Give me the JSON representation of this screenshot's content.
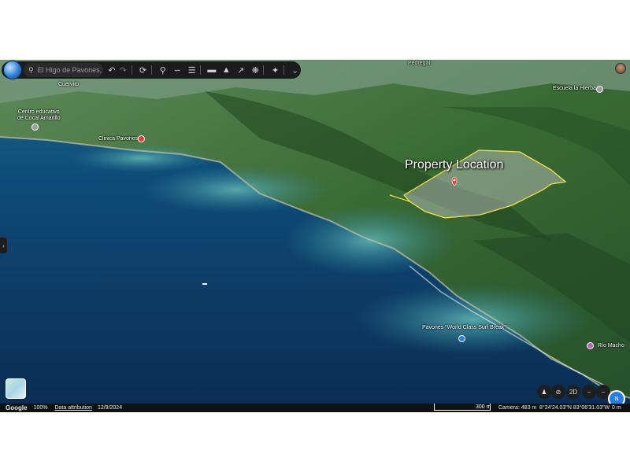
{
  "toolbar": {
    "search_value": "El Higo de Pavones, adjac"
  },
  "places": {
    "cuervito": "Cuervito",
    "pedregal": "Pedregal",
    "centro_line1": "Centro educativo",
    "centro_line2": "de Cocal Amarillo",
    "clinica": "Clinica Pavones",
    "escuela": "Escuela la Hierba",
    "surf_break": "Pavones \"World Class Surf Break\"",
    "rio_macho": "Río Macho"
  },
  "overlay": {
    "property_label": "Property Location",
    "polygon_color": "#f2e24a",
    "marker_color": "#e53935"
  },
  "controls": {
    "view_mode": "2D"
  },
  "status": {
    "brand": "Google",
    "zoom": "100%",
    "attribution": "Data attribution",
    "date": "12/9/2024",
    "scale": "300 m",
    "camera": "Camera: 483 m",
    "coords": "8°24'24.03\"N 83°06'31.03\"W",
    "elevation": "0 m"
  },
  "colors": {
    "toolbar_bg": "#1b1b1d",
    "accent_blue": "#2a7de1",
    "ocean": "#0d3a5c",
    "forest": "#2e5a2c"
  }
}
